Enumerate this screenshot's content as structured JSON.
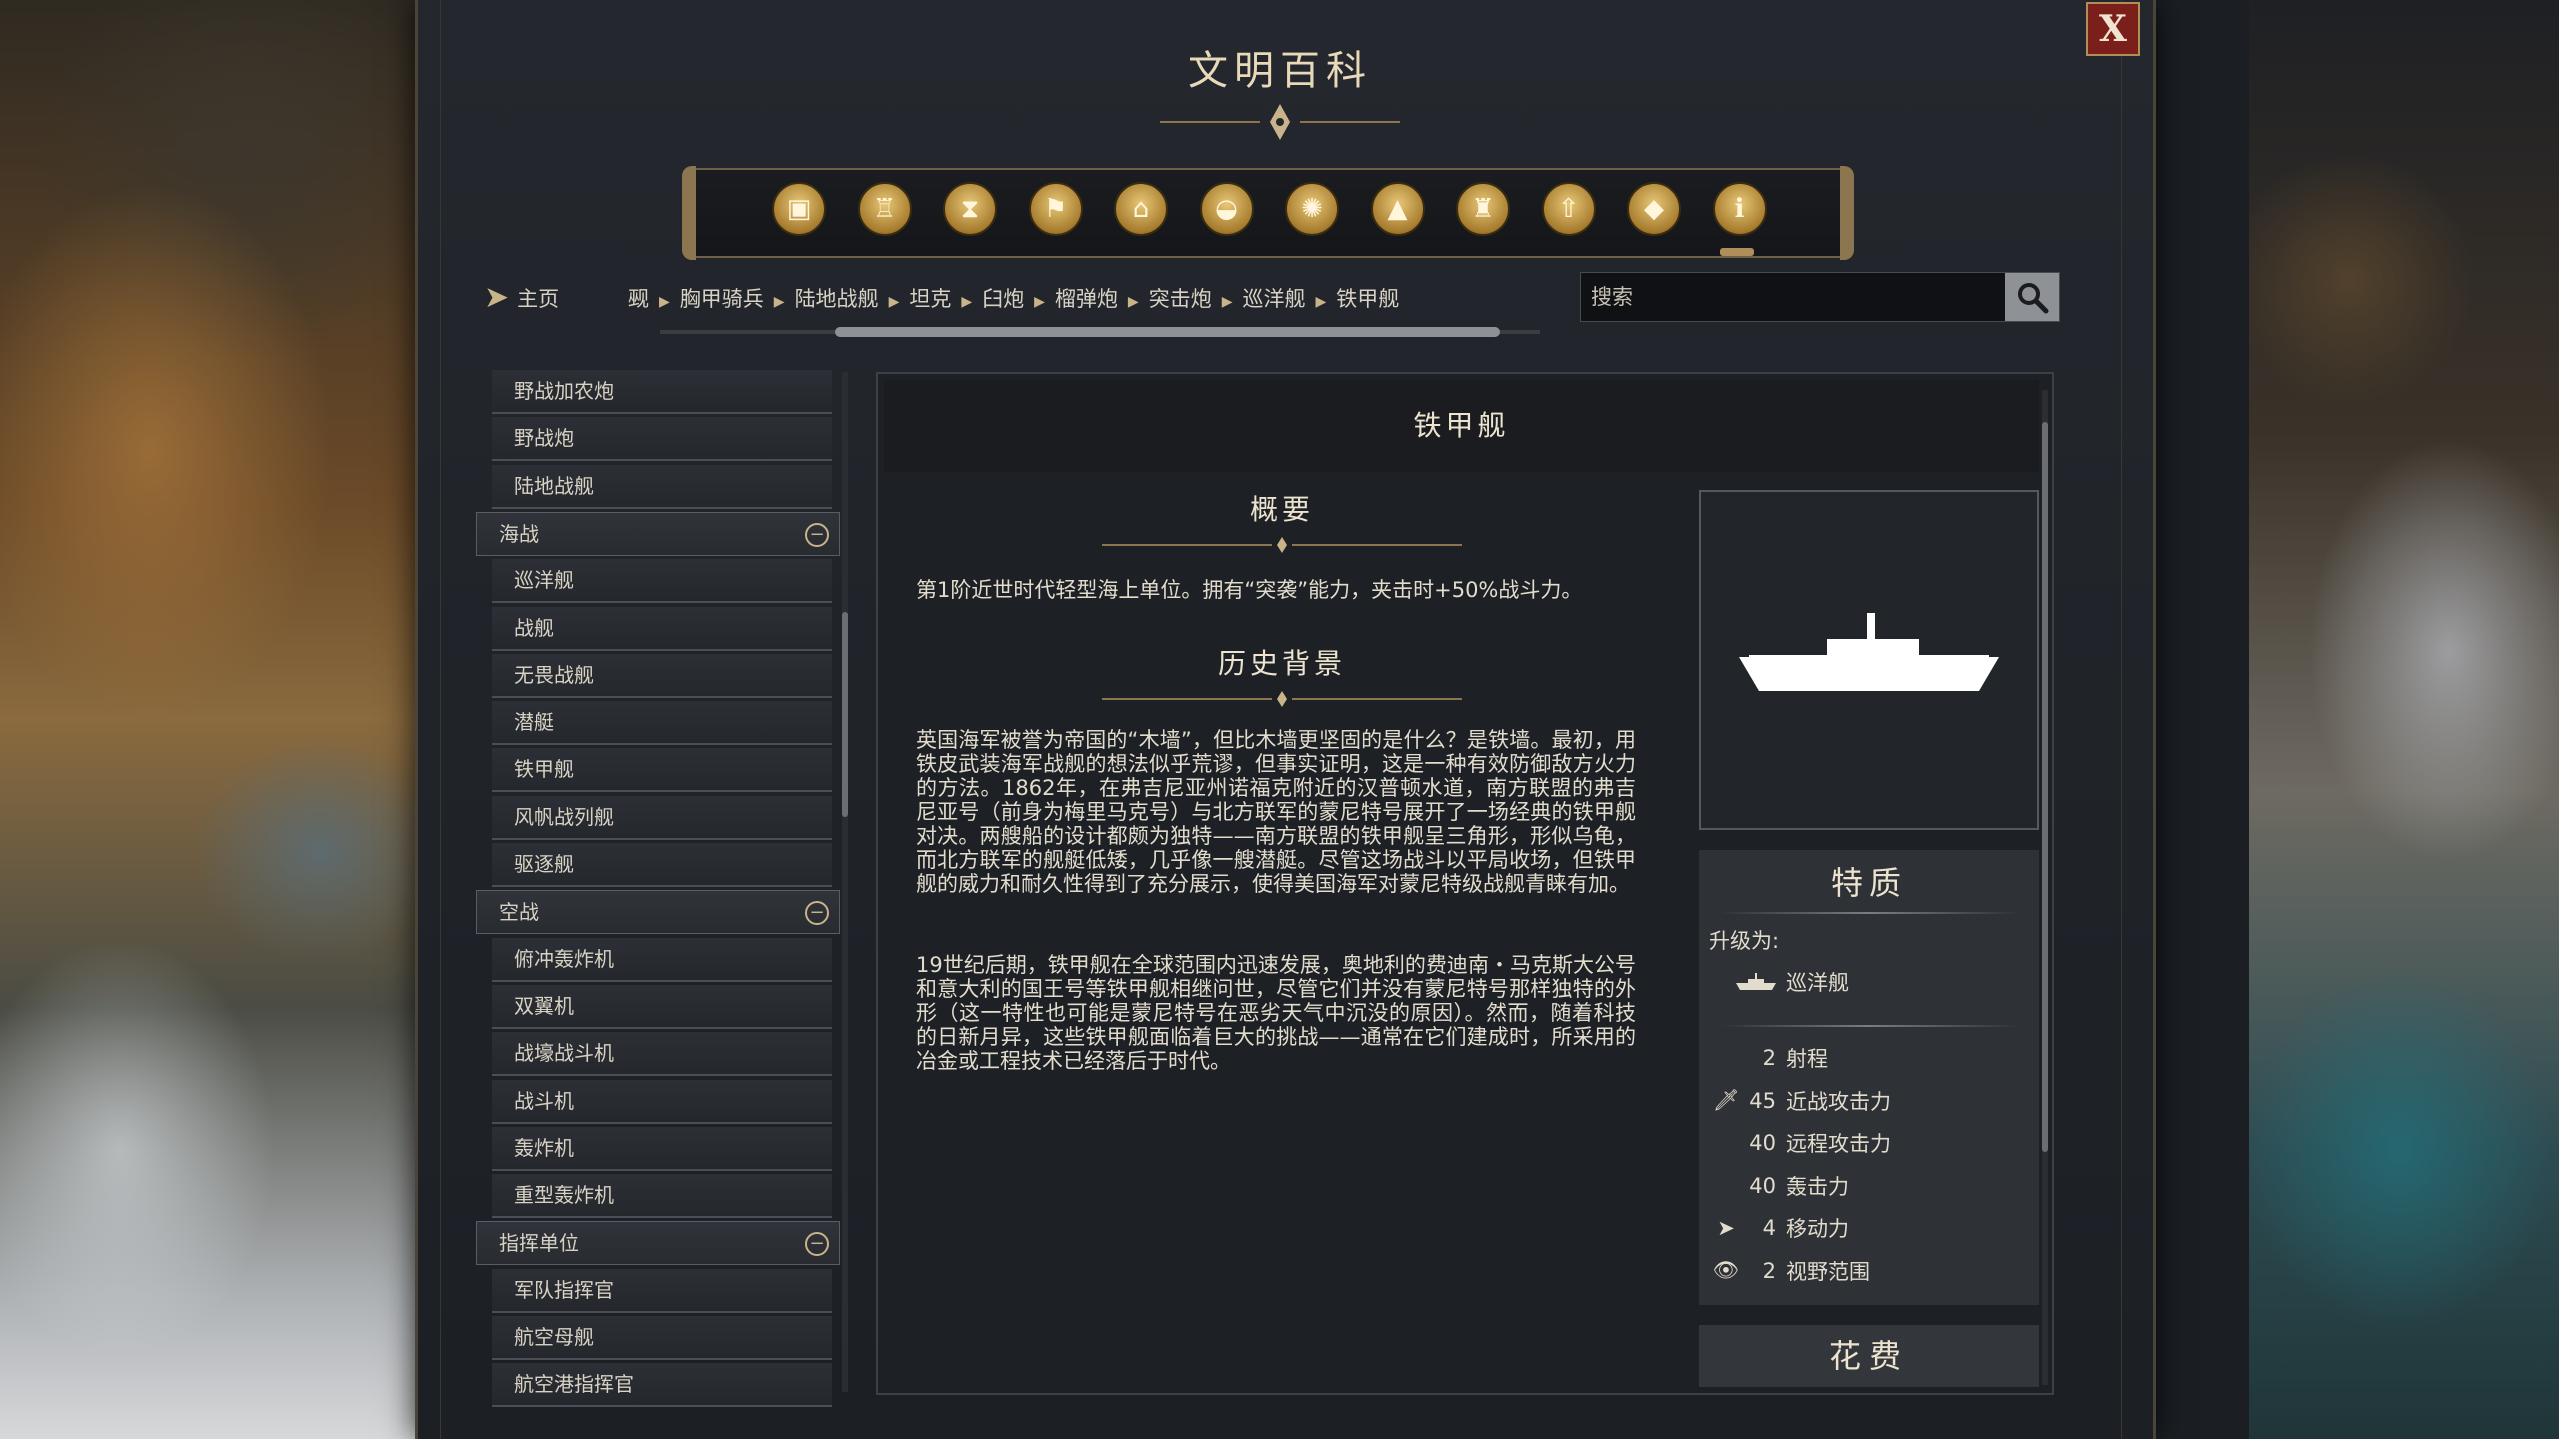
{
  "window": {
    "title": "文明百科",
    "close_label": "X"
  },
  "categories": [
    {
      "icon": "box-icon",
      "glyph": "▣"
    },
    {
      "icon": "goblet-icon",
      "glyph": "♖"
    },
    {
      "icon": "hourglass-icon",
      "glyph": "⧗"
    },
    {
      "icon": "flag-icon",
      "glyph": "⚑"
    },
    {
      "icon": "government-building-icon",
      "glyph": "⌂"
    },
    {
      "icon": "open-book-icon",
      "glyph": "◒"
    },
    {
      "icon": "atom-icon",
      "glyph": "✺"
    },
    {
      "icon": "mountain-icon",
      "glyph": "▲"
    },
    {
      "icon": "tower-icon",
      "glyph": "♜"
    },
    {
      "icon": "upgrade-arrow-icon",
      "glyph": "⇧"
    },
    {
      "icon": "diamond-resource-icon",
      "glyph": "◆"
    },
    {
      "icon": "info-icon",
      "glyph": "ℹ"
    }
  ],
  "breadcrumb": {
    "home_label": "主页",
    "items": [
      "觋",
      "胸甲骑兵",
      "陆地战舰",
      "坦克",
      "臼炮",
      "榴弹炮",
      "突击炮",
      "巡洋舰",
      "铁甲舰"
    ]
  },
  "search": {
    "placeholder": "搜索"
  },
  "list": {
    "items": [
      {
        "label": "野战加农炮",
        "type": "item"
      },
      {
        "label": "野战炮",
        "type": "item"
      },
      {
        "label": "陆地战舰",
        "type": "item"
      },
      {
        "label": "海战",
        "type": "category"
      },
      {
        "label": "巡洋舰",
        "type": "item"
      },
      {
        "label": "战舰",
        "type": "item"
      },
      {
        "label": "无畏战舰",
        "type": "item"
      },
      {
        "label": "潜艇",
        "type": "item"
      },
      {
        "label": "铁甲舰",
        "type": "item"
      },
      {
        "label": "风帆战列舰",
        "type": "item"
      },
      {
        "label": "驱逐舰",
        "type": "item"
      },
      {
        "label": "空战",
        "type": "category"
      },
      {
        "label": "俯冲轰炸机",
        "type": "item"
      },
      {
        "label": "双翼机",
        "type": "item"
      },
      {
        "label": "战壕战斗机",
        "type": "item"
      },
      {
        "label": "战斗机",
        "type": "item"
      },
      {
        "label": "轰炸机",
        "type": "item"
      },
      {
        "label": "重型轰炸机",
        "type": "item"
      },
      {
        "label": "指挥单位",
        "type": "category"
      },
      {
        "label": "军队指挥官",
        "type": "item"
      },
      {
        "label": "航空母舰",
        "type": "item"
      },
      {
        "label": "航空港指挥官",
        "type": "item"
      }
    ]
  },
  "article": {
    "title": "铁甲舰",
    "overview_title": "概要",
    "overview_text": "第1阶近世时代轻型海上单位。拥有“突袭”能力，夹击时+50%战斗力。",
    "history_title": "历史背景",
    "history_p1": "英国海军被誉为帝国的“木墙”，但比木墙更坚固的是什么？是铁墙。最初，用铁皮武装海军战舰的想法似乎荒谬，但事实证明，这是一种有效防御敌方火力的方法。1862年，在弗吉尼亚州诺福克附近的汉普顿水道，南方联盟的弗吉尼亚号（前身为梅里马克号）与北方联军的蒙尼特号展开了一场经典的铁甲舰对决。两艘船的设计都颇为独特——南方联盟的铁甲舰呈三角形，形似乌龟，而北方联军的舰艇低矮，几乎像一艘潜艇。尽管这场战斗以平局收场，但铁甲舰的威力和耐久性得到了充分展示，使得美国海军对蒙尼特级战舰青睐有加。",
    "history_p2": "19世纪后期，铁甲舰在全球范围内迅速发展，奥地利的费迪南・马克斯大公号和意大利的国王号等铁甲舰相继问世，尽管它们并没有蒙尼特号那样独特的外形（这一特性也可能是蒙尼特号在恶劣天气中沉没的原因）。然而，随着科技的日新月异，这些铁甲舰面临着巨大的挑战——通常在它们建成时，所采用的冶金或工程技术已经落后于时代。"
  },
  "traits": {
    "title": "特质",
    "upgrade_label": "升级为:",
    "upgrade_to": "巡洋舰",
    "stats": [
      {
        "icon": "none",
        "value": "2",
        "label": "射程"
      },
      {
        "icon": "sword-icon",
        "value": "45",
        "label": "近战攻击力"
      },
      {
        "icon": "none",
        "value": "40",
        "label": "远程攻击力"
      },
      {
        "icon": "none",
        "value": "40",
        "label": "轰击力"
      },
      {
        "icon": "movement-arrow-icon",
        "value": "4",
        "label": "移动力"
      },
      {
        "icon": "eye-icon",
        "value": "2",
        "label": "视野范围"
      }
    ],
    "cost_title": "花费"
  },
  "colors": {
    "gold": "#c9b48a",
    "close_red": "#7a1f1a",
    "panel": "#1f2328"
  }
}
